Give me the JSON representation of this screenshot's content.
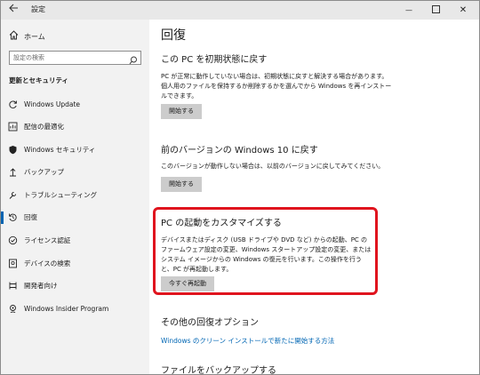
{
  "window": {
    "title": "設定",
    "back_icon": "arrow-left-icon",
    "minimize_glyph": "—",
    "close_glyph": "✕"
  },
  "sidebar": {
    "home_label": "ホーム",
    "search_placeholder": "設定の検索",
    "section_title": "更新とセキュリティ",
    "items": [
      {
        "label": "Windows Update",
        "icon": "refresh-icon"
      },
      {
        "label": "配信の最適化",
        "icon": "delivery-optimization-icon"
      },
      {
        "label": "Windows セキュリティ",
        "icon": "shield-icon"
      },
      {
        "label": "バックアップ",
        "icon": "backup-icon"
      },
      {
        "label": "トラブルシューティング",
        "icon": "wrench-icon"
      },
      {
        "label": "回復",
        "icon": "recovery-icon",
        "active": true
      },
      {
        "label": "ライセンス認証",
        "icon": "check-circle-icon"
      },
      {
        "label": "デバイスの検索",
        "icon": "find-device-icon"
      },
      {
        "label": "開発者向け",
        "icon": "developer-icon"
      },
      {
        "label": "Windows Insider Program",
        "icon": "insider-icon"
      }
    ]
  },
  "main": {
    "page_title": "回復",
    "reset": {
      "heading": "この PC を初期状態に戻す",
      "description": "PC が正常に動作していない場合は、初期状態に戻すと解決する場合があります。個人用のファイルを保持するか削除するかを選んでから Windows を再インストールできます。",
      "button": "開始する"
    },
    "go_back": {
      "heading": "前のバージョンの Windows 10 に戻す",
      "description": "このバージョンが動作しない場合は、以前のバージョンに戻してみてください。",
      "button": "開始する"
    },
    "advanced_startup": {
      "heading": "PC の起動をカスタマイズする",
      "description": "デバイスまたはディスク (USB ドライブや DVD など) からの起動、PC のファームウェア設定の変更、Windows スタートアップ設定の変更、またはシステム イメージからの Windows の復元を行います。この操作を行うと、PC が再起動します。",
      "button": "今すぐ再起動"
    },
    "more_options": {
      "heading": "その他の回復オプション",
      "link": "Windows のクリーン インストールで新たに開始する方法"
    },
    "backup": {
      "heading": "ファイルをバックアップする"
    }
  },
  "colors": {
    "accent": "#0063b1",
    "link": "#0066b4",
    "highlight_border": "#e0141e",
    "sidebar_bg": "#f2f2f2",
    "button_bg": "#cccccc"
  }
}
